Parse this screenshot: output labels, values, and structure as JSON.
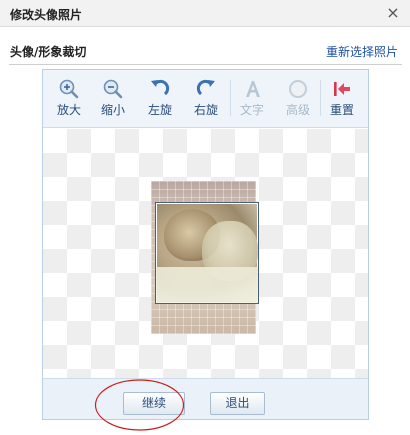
{
  "dialog": {
    "title": "修改头像照片",
    "close_glyph": "×"
  },
  "section": {
    "label": "头像/形象裁切",
    "reselect_link": "重新选择照片"
  },
  "toolbar": {
    "tools": [
      {
        "label": "放大",
        "icon": "zoom-in-icon",
        "enabled": true
      },
      {
        "label": "缩小",
        "icon": "zoom-out-icon",
        "enabled": true
      },
      {
        "label": "左旋",
        "icon": "rotate-left-icon",
        "enabled": true
      },
      {
        "label": "右旋",
        "icon": "rotate-right-icon",
        "enabled": true
      },
      {
        "label": "文字",
        "icon": "text-icon",
        "enabled": false
      },
      {
        "label": "高级",
        "icon": "advanced-icon",
        "enabled": false
      },
      {
        "label": "重置",
        "icon": "reset-icon",
        "enabled": true
      }
    ]
  },
  "buttons": {
    "continue_label": "继续",
    "exit_label": "退出"
  },
  "colors": {
    "accent": "#1e50a2",
    "toolbar_bg": "#eef4fa",
    "annotation": "#c8201f"
  }
}
